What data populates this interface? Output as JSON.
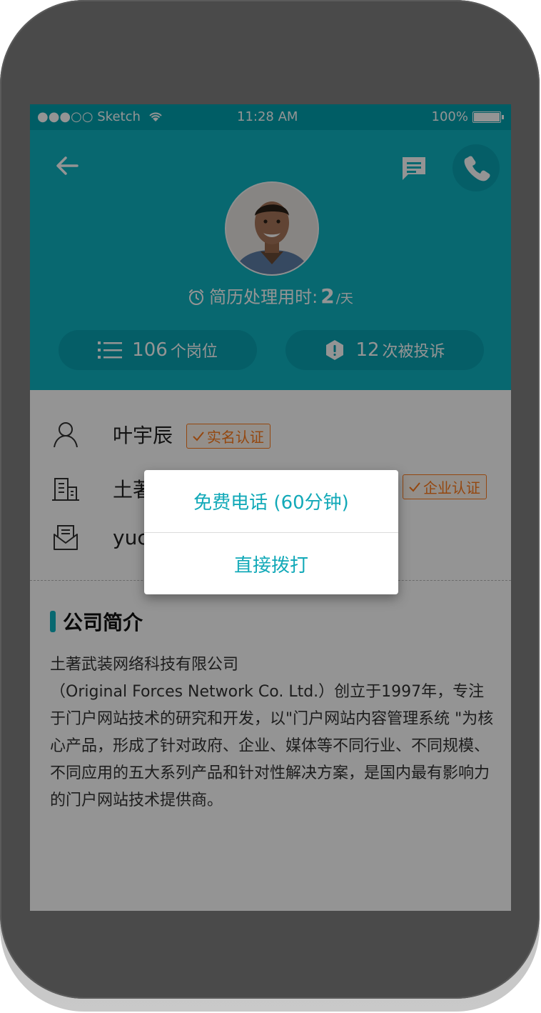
{
  "status_bar": {
    "carrier": "●●●○○ Sketch",
    "time": "11:28 AM",
    "battery": "100%"
  },
  "header": {
    "processing_label": "简历处理用时:",
    "processing_value": "2",
    "processing_unit": "/天",
    "positions_count": "106",
    "positions_label": "个岗位",
    "complaints_count": "12",
    "complaints_label": "次被投诉"
  },
  "profile": {
    "name": "叶宇辰",
    "name_badge": "实名认证",
    "company_visible": "土著",
    "company_badge": "企业认证",
    "email_visible": "yuc"
  },
  "section": {
    "title": "公司简介",
    "body": "土著武装网络科技有限公司\n（Original Forces Network Co. Ltd.）创立于1997年，专注于门户网站技术的研究和开发，以\"门户网站内容管理系统 \"为核心产品，形成了针对政府、企业、媒体等不同行业、不同规模、不同应用的五大系列产品和针对性解决方案，是国内最有影响力的门户网站技术提供商。"
  },
  "dialog": {
    "option_free_call": "免费电话 (60分钟)",
    "option_direct_call": "直接拨打"
  },
  "colors": {
    "teal": "#0fb3c2",
    "badge_orange": "#ff7a1a"
  },
  "icons": [
    "back-arrow-icon",
    "message-icon",
    "phone-icon",
    "alarm-clock-icon",
    "list-icon",
    "alert-icon",
    "person-icon",
    "building-icon",
    "mail-icon",
    "check-icon"
  ]
}
